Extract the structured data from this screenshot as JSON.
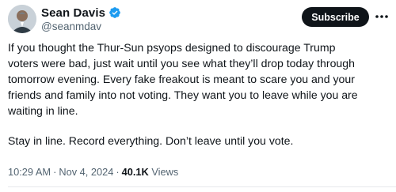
{
  "author": {
    "display_name": "Sean Davis",
    "handle": "@seanmdav",
    "avatar_icon": "person-avatar-icon",
    "verified_icon": "verified-badge-icon",
    "verified_color": "#1d9bf0"
  },
  "actions": {
    "subscribe_label": "Subscribe",
    "more_icon": "more-icon"
  },
  "tweet": {
    "paragraphs": [
      "If you thought the Thur-Sun psyops designed to discourage Trump\nvoters were bad, just wait until you see what they’ll drop today through\ntomorrow evening. Every fake freakout is meant to scare you and your\nfriends and family into not voting. They want you to leave while you are\nwaiting in line.",
      "Stay in line. Record everything. Don’t leave until you vote."
    ]
  },
  "meta": {
    "time": "10:29 AM",
    "date": "Nov 4, 2024",
    "views_count": "40.1K",
    "views_label": "Views",
    "separator": "·"
  },
  "colors": {
    "text": "#0f1419",
    "secondary_text": "#536471",
    "button_bg": "#0f1419",
    "button_text": "#ffffff"
  }
}
